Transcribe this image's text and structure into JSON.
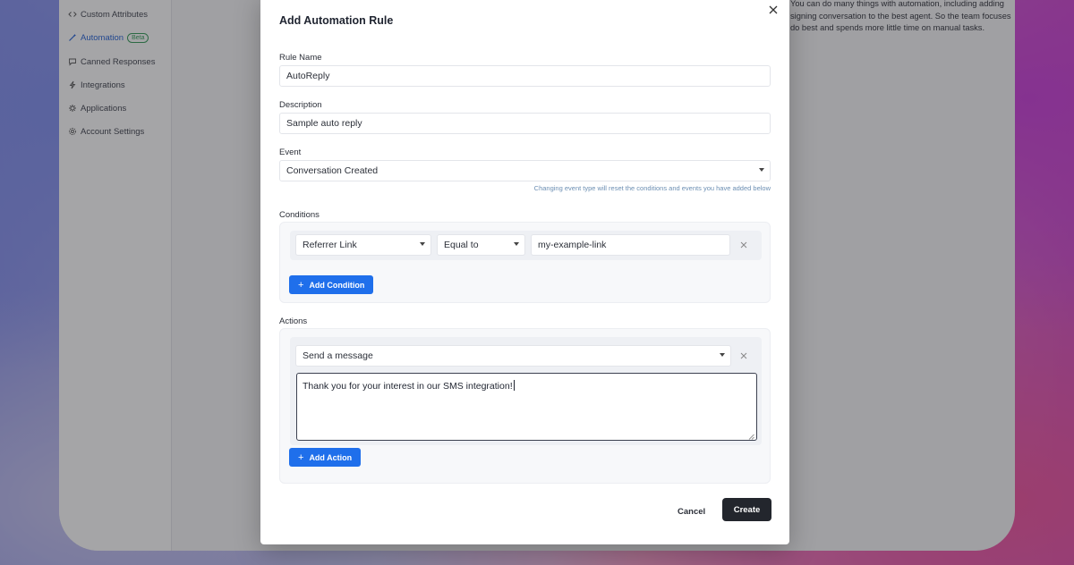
{
  "sidebar": {
    "items": [
      {
        "label": "Custom Attributes",
        "icon": "code-icon"
      },
      {
        "label": "Automation",
        "icon": "wand-icon",
        "badge": "Beta",
        "active": true
      },
      {
        "label": "Canned Responses",
        "icon": "chat-icon"
      },
      {
        "label": "Integrations",
        "icon": "bolt-icon"
      },
      {
        "label": "Applications",
        "icon": "apps-icon"
      },
      {
        "label": "Account Settings",
        "icon": "gear-icon"
      }
    ]
  },
  "main": {
    "description_lines": [
      "You can do many things with automation, including adding",
      "signing conversation to the best agent. So the team focuses",
      "do best and spends more little time on manual tasks."
    ]
  },
  "modal": {
    "title": "Add Automation Rule",
    "rule_name": {
      "label": "Rule Name",
      "value": "AutoReply"
    },
    "description": {
      "label": "Description",
      "value": "Sample auto reply"
    },
    "event": {
      "label": "Event",
      "value": "Conversation Created",
      "hint": "Changing event type will reset the conditions and events you have added below"
    },
    "conditions": {
      "label": "Conditions",
      "rows": [
        {
          "attribute": "Referrer Link",
          "operator": "Equal to",
          "value": "my-example-link"
        }
      ],
      "add_label": "Add Condition"
    },
    "actions": {
      "label": "Actions",
      "rows": [
        {
          "action": "Send a message",
          "message": "Thank you for your interest in our SMS integration!"
        }
      ],
      "add_label": "Add Action"
    },
    "cancel_label": "Cancel",
    "create_label": "Create"
  },
  "colors": {
    "primary": "#1f6feb",
    "create_button": "#23262d",
    "active_nav": "#1f5fd6",
    "beta_badge": "#2f9a55",
    "hint_text": "#6c8fb3"
  }
}
